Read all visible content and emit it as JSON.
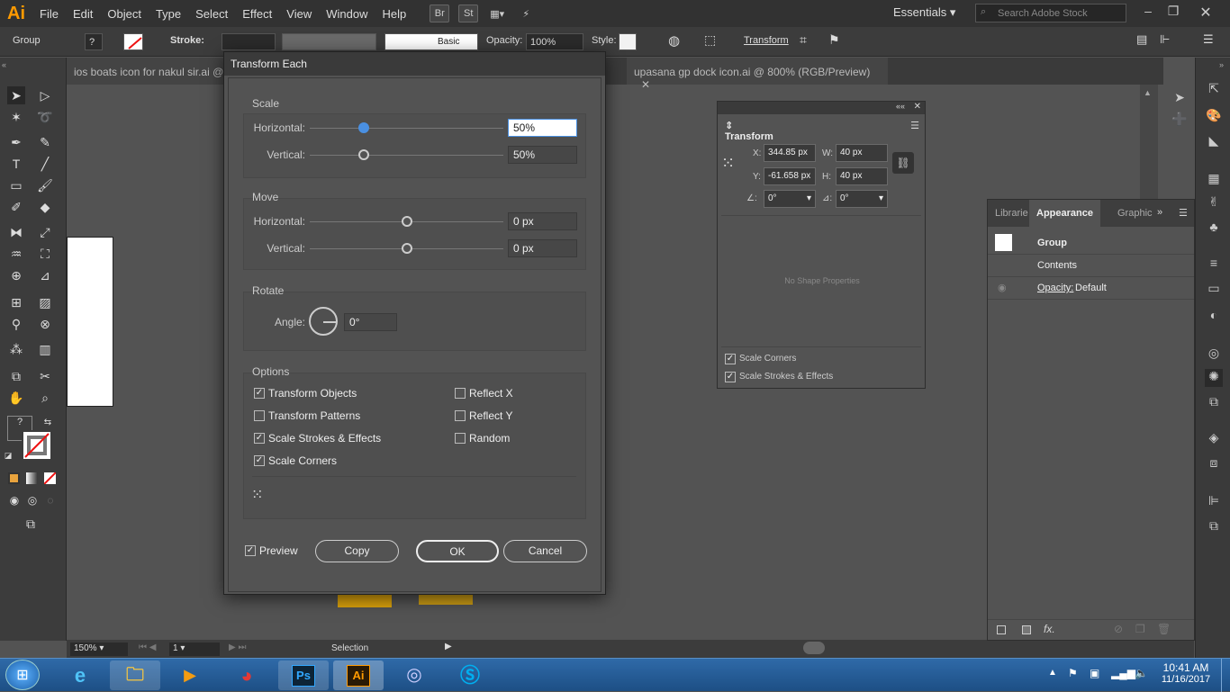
{
  "menubar": {
    "logo": "Ai",
    "items": [
      "File",
      "Edit",
      "Object",
      "Type",
      "Select",
      "Effect",
      "View",
      "Window",
      "Help"
    ],
    "br": "Br",
    "st": "St",
    "workspace": "Essentials",
    "search_placeholder": "Search Adobe Stock"
  },
  "control": {
    "selection": "Group",
    "stroke_label": "Stroke:",
    "brush": "Basic",
    "opacity_label": "Opacity:",
    "opacity_value": "100%",
    "style_label": "Style:",
    "transform": "Transform"
  },
  "tabs": [
    {
      "label": "ios boats icon for nakul sir.ai @"
    },
    {
      "label": "upasana gp dock icon.ai @ 800% (RGB/Preview)"
    }
  ],
  "status": {
    "zoom": "150%",
    "page": "1",
    "tool": "Selection"
  },
  "transform_panel": {
    "title": "Transform",
    "x_label": "X:",
    "x": "344.85 px",
    "y_label": "Y:",
    "y": "-61.658 px",
    "w_label": "W:",
    "w": "40 px",
    "h_label": "H:",
    "h": "40 px",
    "angle": "0°",
    "shear": "0°",
    "empty": "No Shape Properties",
    "scale_corners": "Scale Corners",
    "scale_strokes": "Scale Strokes & Effects"
  },
  "appearance_panel": {
    "tabs": [
      "Librarie",
      "Appearance",
      "Graphic"
    ],
    "group": "Group",
    "contents": "Contents",
    "opacity_label": "Opacity:",
    "opacity_value": "Default",
    "fx": "fx."
  },
  "dialog": {
    "title": "Transform Each",
    "scale": {
      "heading": "Scale",
      "h_label": "Horizontal:",
      "h_value": "50%",
      "h_level": 0.28,
      "v_label": "Vertical:",
      "v_value": "50%",
      "v_level": 0.28
    },
    "move": {
      "heading": "Move",
      "h_label": "Horizontal:",
      "h_value": "0 px",
      "h_level": 0.5,
      "v_label": "Vertical:",
      "v_value": "0 px",
      "v_level": 0.5
    },
    "rotate": {
      "heading": "Rotate",
      "angle_label": "Angle:",
      "angle_value": "0°"
    },
    "options": {
      "heading": "Options",
      "transform_objects": "Transform Objects",
      "transform_patterns": "Transform Patterns",
      "scale_strokes": "Scale Strokes & Effects",
      "scale_corners": "Scale Corners",
      "reflect_x": "Reflect X",
      "reflect_y": "Reflect Y",
      "random": "Random"
    },
    "preview": "Preview",
    "copy": "Copy",
    "ok": "OK",
    "cancel": "Cancel"
  },
  "taskbar": {
    "ps": "Ps",
    "ai": "Ai",
    "time": "10:41 AM",
    "date": "11/16/2017"
  },
  "colors": {
    "accent": "#4a90e2",
    "ai_orange": "#ff9a00",
    "taskbar": "#1d4f85"
  }
}
